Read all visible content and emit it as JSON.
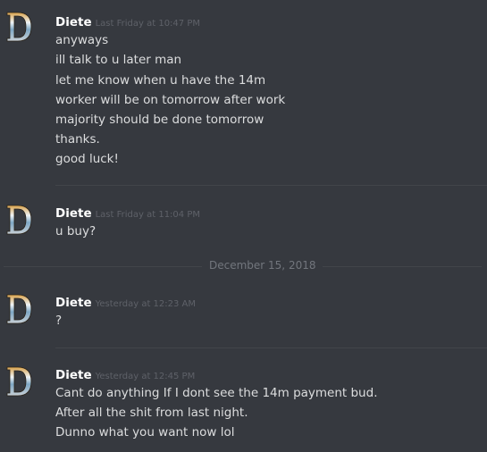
{
  "messages": [
    {
      "author": "Diete",
      "timestamp": "Last Friday at 10:47 PM",
      "lines": [
        "anyways",
        "ill talk to u later man",
        "let me know when u have the 14m",
        "worker will be on tomorrow after work",
        "majority should be done tomorrow",
        "thanks.",
        "good luck!"
      ]
    },
    {
      "author": "Diete",
      "timestamp": "Last Friday at 11:04 PM",
      "lines": [
        "u buy?"
      ]
    },
    {
      "author": "Diete",
      "timestamp": "Yesterday at 12:23 AM",
      "lines": [
        "?"
      ]
    },
    {
      "author": "Diete",
      "timestamp": "Yesterday at 12:45 PM",
      "lines": [
        "Cant do anything If I dont see the 14m payment bud.",
        "After all the shit from last night.",
        "Dunno what you want now lol"
      ]
    }
  ],
  "date_divider": "December 15, 2018",
  "avatar_icon": "letter-d-avatar-icon",
  "colors": {
    "background": "#36393f",
    "author": "#ffffff",
    "timestamp": "#5e6168",
    "message_text": "#dcddde",
    "divider": "#42454a"
  }
}
